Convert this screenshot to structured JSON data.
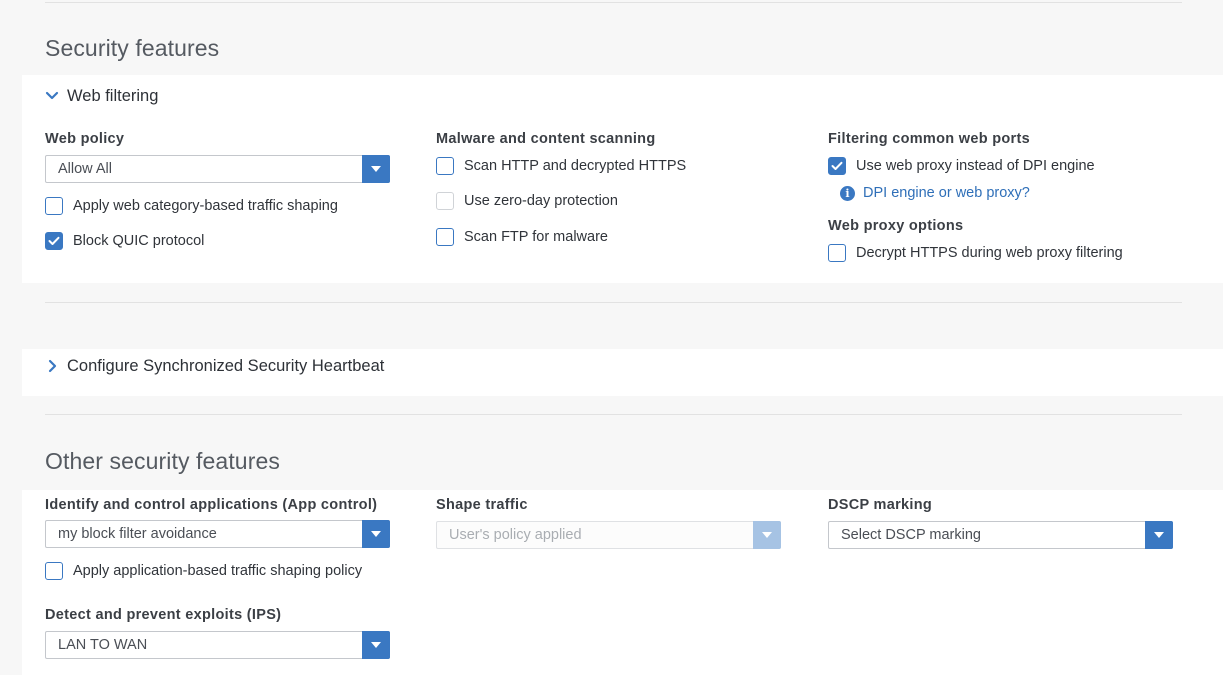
{
  "security": {
    "title": "Security features",
    "web_filtering": {
      "label": "Web filtering",
      "web_policy": {
        "label": "Web policy",
        "value": "Allow All",
        "opt_traffic_shaping": "Apply web category-based traffic shaping",
        "opt_block_quic": "Block QUIC protocol"
      },
      "malware": {
        "label": "Malware and content scanning",
        "opt_scan_http": "Scan HTTP and decrypted HTTPS",
        "opt_zero_day": "Use zero-day protection",
        "opt_scan_ftp": "Scan FTP for malware"
      },
      "ports": {
        "label": "Filtering common web ports",
        "opt_use_proxy": "Use web proxy instead of DPI engine",
        "info_link": "DPI engine or web proxy?",
        "proxy_options_label": "Web proxy options",
        "opt_decrypt_https": "Decrypt HTTPS during web proxy filtering"
      }
    },
    "heartbeat": {
      "label": "Configure Synchronized Security Heartbeat"
    }
  },
  "other": {
    "title": "Other security features",
    "app_control": {
      "label": "Identify and control applications (App control)",
      "value": "my block filter avoidance",
      "opt_app_shaping": "Apply application-based traffic shaping policy"
    },
    "shape_traffic": {
      "label": "Shape traffic",
      "value": "User's policy applied"
    },
    "dscp": {
      "label": "DSCP marking",
      "value": "Select DSCP marking"
    },
    "ips": {
      "label": "Detect and prevent exploits (IPS)",
      "value": "LAN TO WAN"
    }
  },
  "icons": {
    "expanded": "chevron-down-icon",
    "collapsed": "chevron-right-icon",
    "dropdown": "caret-down-icon",
    "check": "check-icon",
    "info": "info-icon"
  },
  "colors": {
    "accent": "#3a78c2",
    "link": "#2f6fb8",
    "disabled_accent": "#a6c3e4"
  }
}
